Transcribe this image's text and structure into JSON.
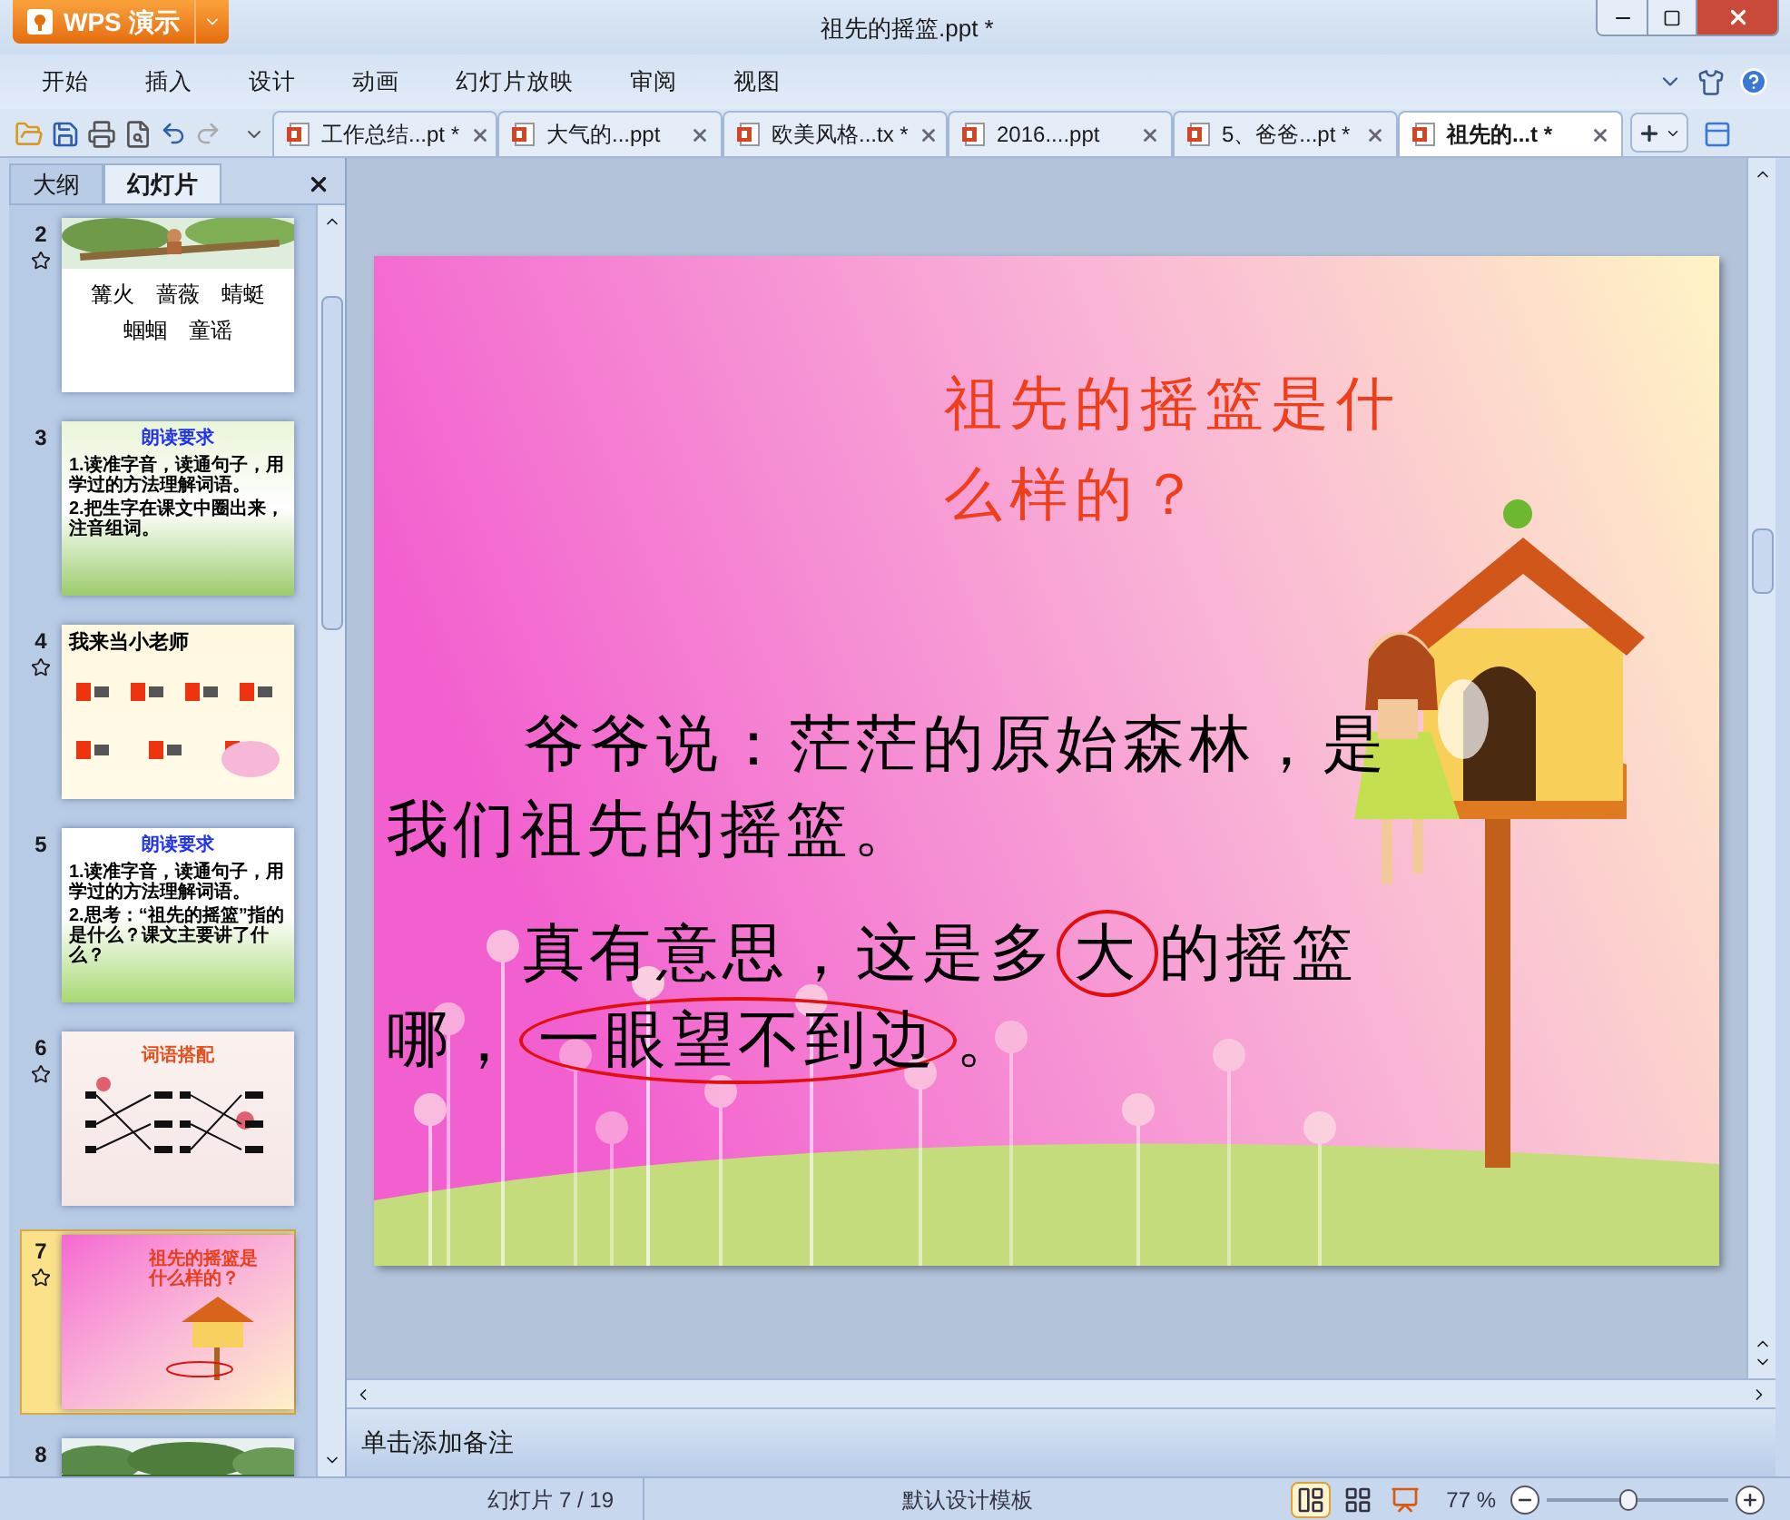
{
  "app_button": {
    "label": "WPS 演示"
  },
  "window": {
    "title": "祖先的摇篮.ppt *"
  },
  "menu": [
    "开始",
    "插入",
    "设计",
    "动画",
    "幻灯片放映",
    "审阅",
    "视图"
  ],
  "doc_tabs": [
    {
      "label": "工作总结...pt *",
      "selected": false
    },
    {
      "label": "大气的...ppt",
      "selected": false
    },
    {
      "label": "欧美风格...tx *",
      "selected": false
    },
    {
      "label": "2016....ppt",
      "selected": false
    },
    {
      "label": "5、爸爸...pt *",
      "selected": false
    },
    {
      "label": "祖先的...t *",
      "selected": true
    }
  ],
  "panel_tabs": [
    {
      "label": "大纲",
      "selected": false
    },
    {
      "label": "幻灯片",
      "selected": true
    }
  ],
  "slides": [
    {
      "number": "2",
      "animated": true,
      "selected": false,
      "kind": "words",
      "words": [
        [
          "篝火",
          "蔷薇",
          "蜻蜓"
        ],
        [
          "蝈蝈",
          "童谣"
        ]
      ]
    },
    {
      "number": "3",
      "animated": false,
      "selected": false,
      "kind": "leaves",
      "title": "朗读要求",
      "lines": [
        "1.读准字音，读通句子，用学过的方法理解词语。",
        "2.把生字在课文中圈出来，注音组词。"
      ]
    },
    {
      "number": "4",
      "animated": true,
      "selected": false,
      "kind": "teacher",
      "title": "我来当小老师"
    },
    {
      "number": "5",
      "animated": false,
      "selected": false,
      "kind": "swing",
      "title": "朗读要求",
      "lines": [
        "1.读准字音，读通句子，用学过的方法理解词语。",
        "2.思考：“祖先的摇篮”指的是什么？课文主要讲了什么？"
      ]
    },
    {
      "number": "6",
      "animated": true,
      "selected": false,
      "kind": "match",
      "title": "词语搭配"
    },
    {
      "number": "7",
      "animated": true,
      "selected": true,
      "kind": "cradle",
      "title": "祖先的摇篮是什么样的？"
    },
    {
      "number": "8",
      "animated": false,
      "selected": false,
      "kind": "forest"
    }
  ],
  "slide": {
    "title": "祖先的摇篮是什么样的？",
    "paragraphs": [
      [
        {
          "text": "爷爷说：茫茫的原始森林，是我们祖先的摇篮。",
          "circled": false
        }
      ],
      [
        {
          "text": "真有意思，这是多",
          "circled": false
        },
        {
          "text": "大",
          "circled": true
        },
        {
          "text": "的摇篮哪，",
          "circled": false
        },
        {
          "text": "一眼望不到边",
          "circled": true
        },
        {
          "text": "。",
          "circled": false
        }
      ]
    ]
  },
  "notes": {
    "placeholder": "单击添加备注"
  },
  "status_bar": {
    "slide_counter": "幻灯片 7 / 19",
    "template": "默认设计模板",
    "views": [
      {
        "kind": "normal",
        "selected": true
      },
      {
        "kind": "sorter",
        "selected": false
      },
      {
        "kind": "show",
        "selected": false
      }
    ],
    "zoom": "77 %",
    "zoom_slider": {
      "level": 0.45
    }
  }
}
